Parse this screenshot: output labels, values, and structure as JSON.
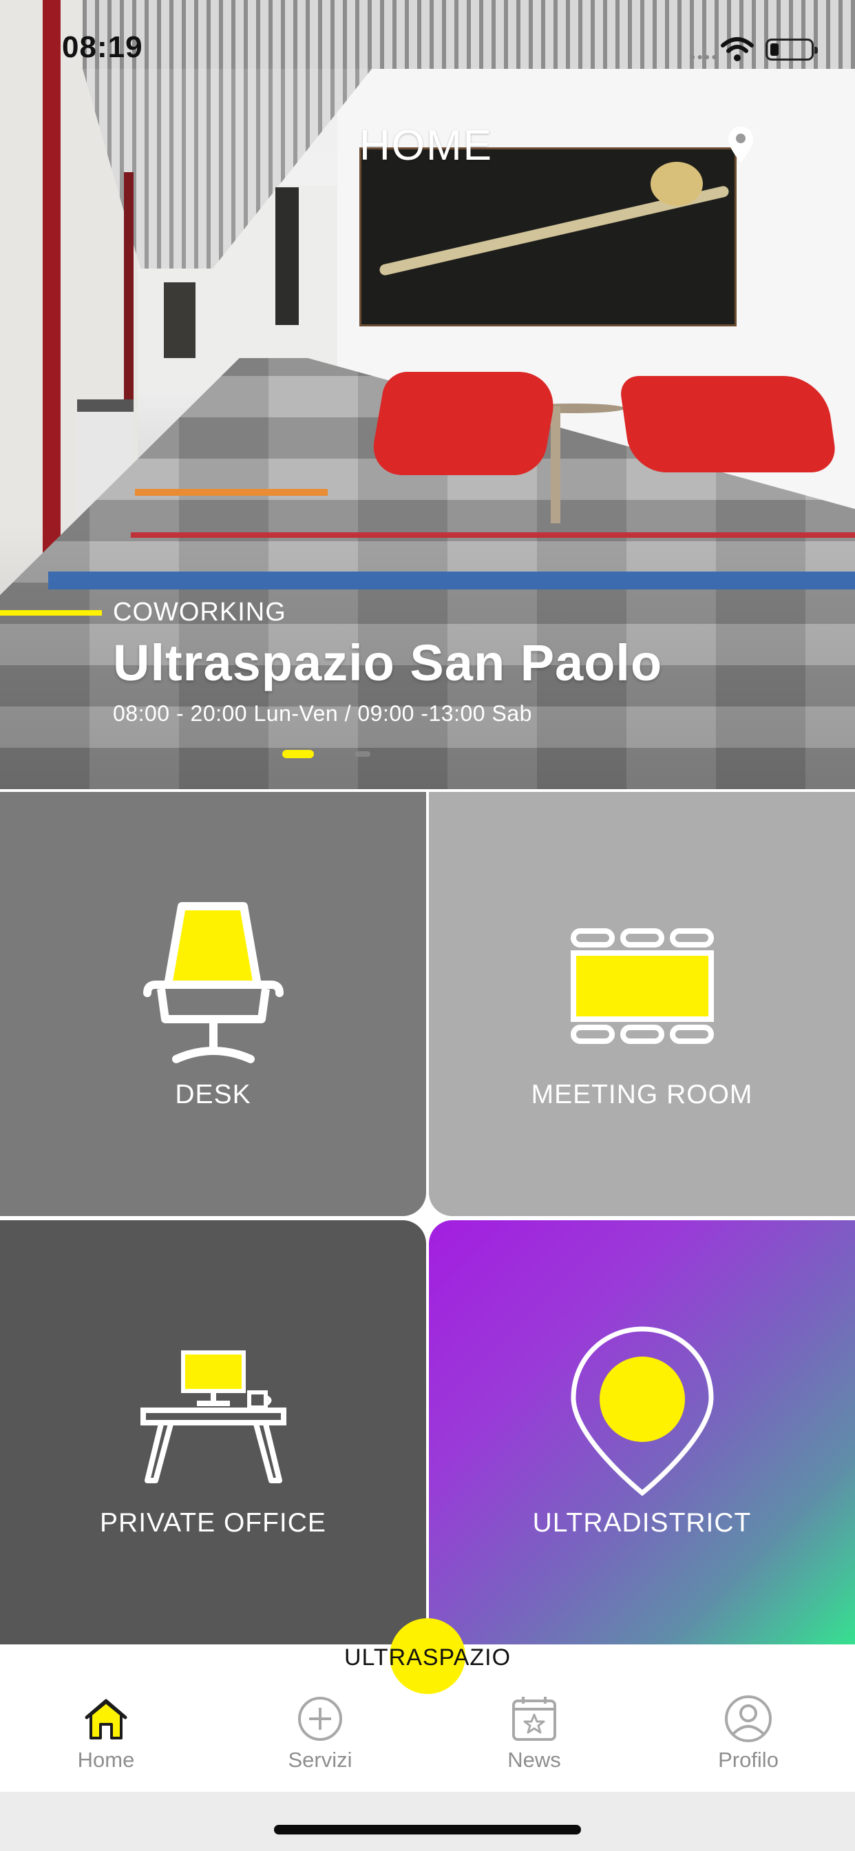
{
  "status_bar": {
    "time": "08:19"
  },
  "hero": {
    "title": "HOME",
    "category": "COWORKING",
    "name": "Ultraspazio San Paolo",
    "hours": "08:00 - 20:00 Lun-Ven / 09:00 -13:00 Sab",
    "pager": {
      "count": 2,
      "active_index": 0
    }
  },
  "tiles": [
    {
      "label": "DESK",
      "icon": "desk-chair-icon"
    },
    {
      "label": "MEETING ROOM",
      "icon": "meeting-room-icon"
    },
    {
      "label": "PRIVATE OFFICE",
      "icon": "private-office-icon"
    },
    {
      "label": "ULTRADISTRICT",
      "icon": "location-pin-icon"
    }
  ],
  "brand": {
    "text": "ULTRASPAZIO"
  },
  "tabbar": {
    "items": [
      {
        "label": "Home",
        "icon": "home-icon",
        "active": true
      },
      {
        "label": "Servizi",
        "icon": "plus-circle-icon",
        "active": false
      },
      {
        "label": "News",
        "icon": "calendar-star-icon",
        "active": false
      },
      {
        "label": "Profilo",
        "icon": "user-icon",
        "active": false
      }
    ]
  },
  "colors": {
    "accent": "#fff200",
    "tile_desk": "#7a7a7a",
    "tile_meeting": "#adadad",
    "tile_office": "#575757",
    "tile_district_gradient": [
      "#a31ee0",
      "#36e090"
    ],
    "tab_inactive": "#8e8e8e"
  }
}
